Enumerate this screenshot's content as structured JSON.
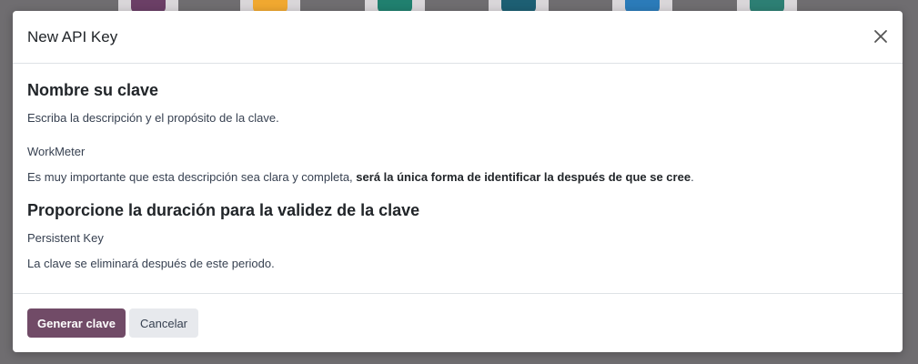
{
  "modal": {
    "title": "New API Key",
    "close_label": "×"
  },
  "name_section": {
    "heading": "Nombre su clave",
    "instruction": "Escriba la descripción y el propósito de la clave.",
    "key_name_value": "WorkMeter",
    "note_prefix": "Es muy importante que esta descripción sea clara y completa, ",
    "note_bold": "será la única forma de identificar la después de que se cree",
    "note_suffix": "."
  },
  "duration_section": {
    "heading": "Proporcione la duración para la validez de la clave",
    "duration_value": "Persistent Key",
    "hint": "La clave se eliminará después de este periodo."
  },
  "footer": {
    "generate_label": "Generar clave",
    "cancel_label": "Cancelar"
  },
  "colors": {
    "primary": "#714b67",
    "secondary": "#e7e9ed",
    "backdrop": "#6f6d70"
  }
}
